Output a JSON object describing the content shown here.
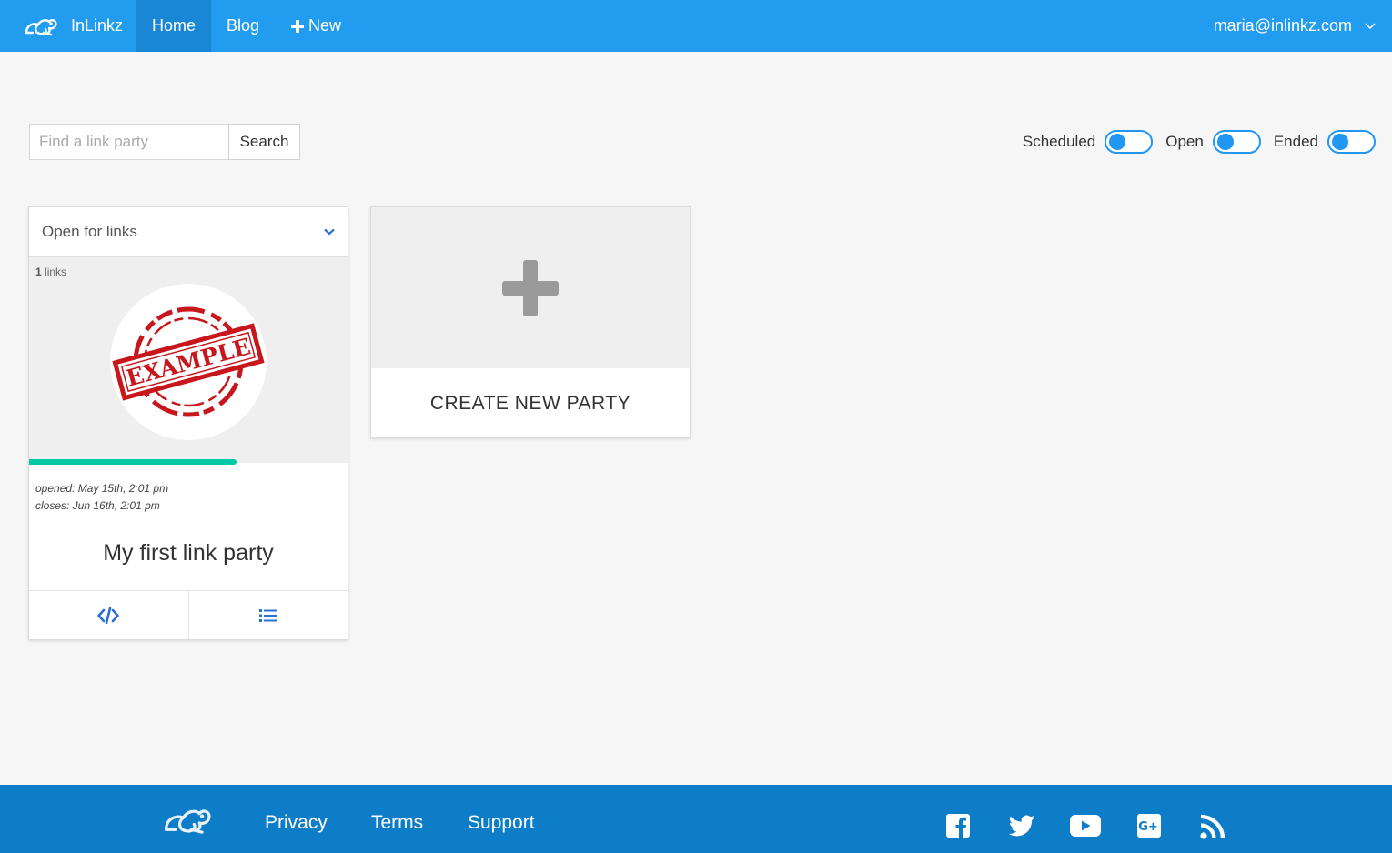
{
  "header": {
    "brand": "InLinkz",
    "nav": [
      {
        "label": "Home",
        "active": true
      },
      {
        "label": "Blog",
        "active": false
      },
      {
        "label": "New",
        "icon": "plus-icon"
      }
    ],
    "user_email": "maria@inlinkz.com"
  },
  "search": {
    "placeholder": "Find a link party",
    "button_label": "Search"
  },
  "filters": [
    {
      "label": "Scheduled",
      "enabled": false
    },
    {
      "label": "Open",
      "enabled": false
    },
    {
      "label": "Ended",
      "enabled": false
    }
  ],
  "party_card": {
    "status": "Open for links",
    "link_count": "1",
    "link_count_label": "links",
    "image_text": "EXAMPLE",
    "progress": 0.65,
    "opened": "opened: May 15th, 2:01 pm",
    "closes": "closes: Jun 16th, 2:01 pm",
    "title": "My first link party",
    "actions": [
      "code-icon",
      "list-icon"
    ]
  },
  "create_card": {
    "label": "CREATE NEW PARTY"
  },
  "footer": {
    "links": [
      "Privacy",
      "Terms",
      "Support"
    ],
    "social": [
      "facebook-icon",
      "twitter-icon",
      "youtube-icon",
      "google-plus-icon",
      "rss-icon"
    ]
  },
  "colors": {
    "header": "#219cee",
    "header_active": "#1a87d6",
    "footer": "#0e7dc8",
    "toggle": "#2196f3",
    "progress": "#00c8a4",
    "stamp": "#c8161d"
  }
}
